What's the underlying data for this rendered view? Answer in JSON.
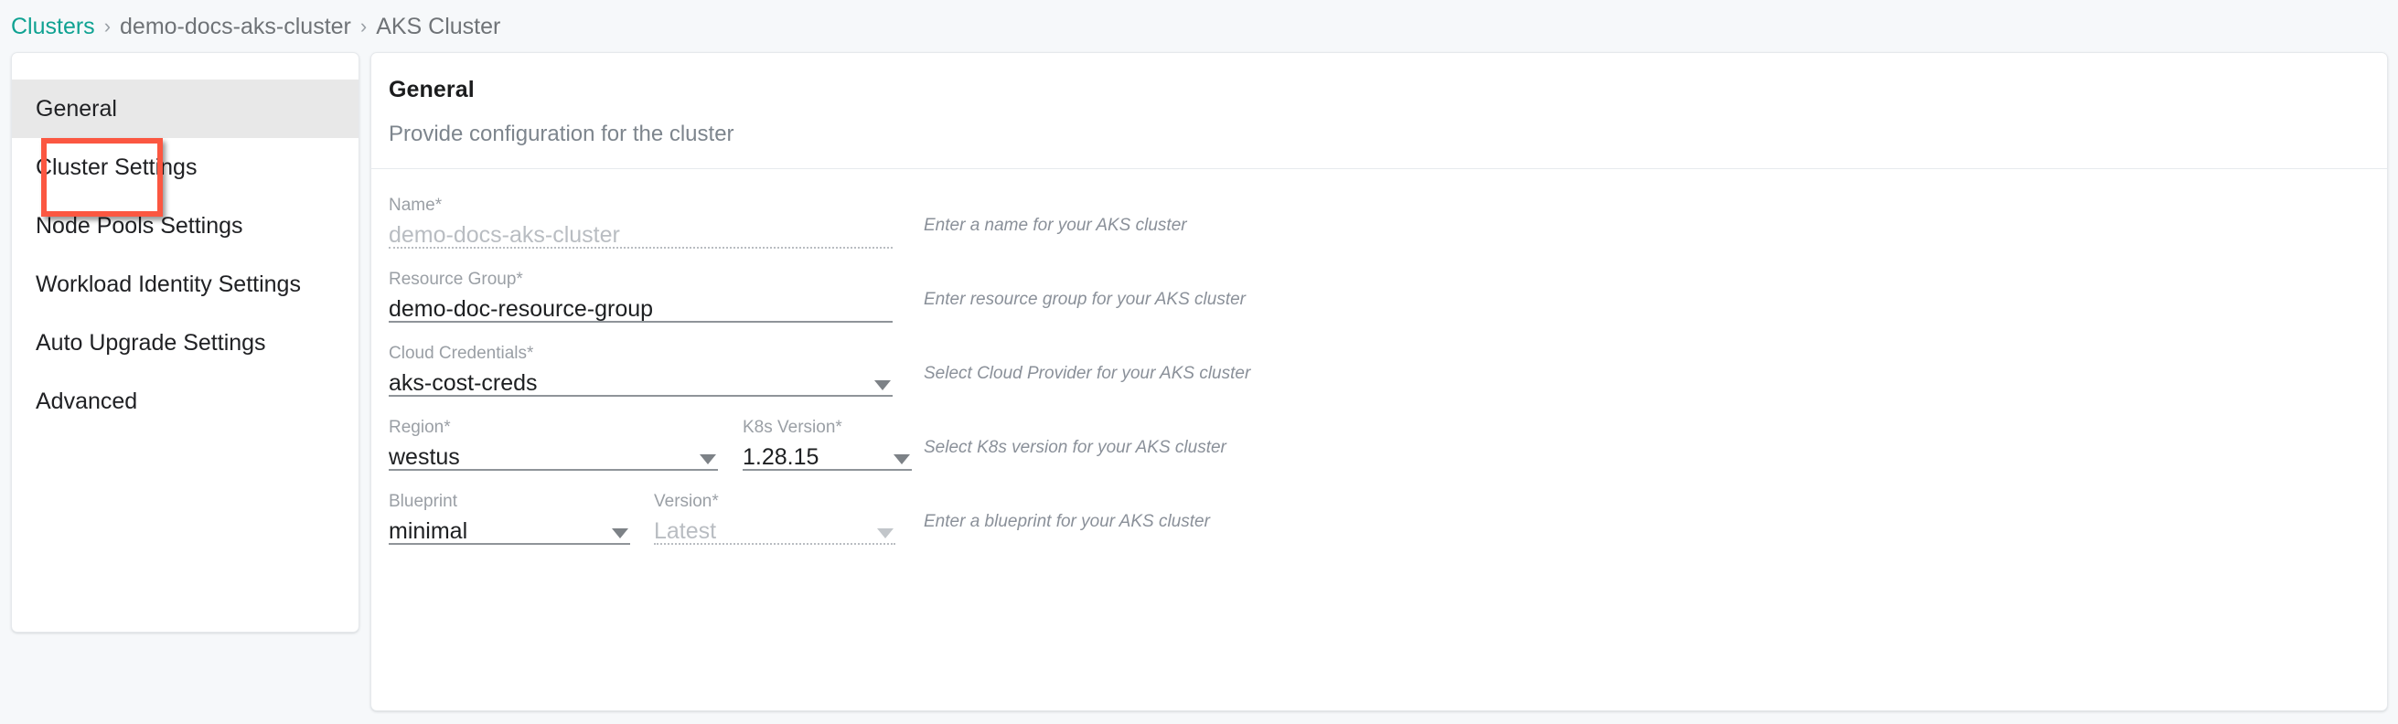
{
  "breadcrumb": {
    "root": "Clusters",
    "separator": "›",
    "cluster": "demo-docs-aks-cluster",
    "current": "AKS Cluster",
    "link_color": "#0fa292"
  },
  "sidebar": {
    "items": [
      {
        "label": "General",
        "selected": true
      },
      {
        "label": "Cluster Settings",
        "selected": false
      },
      {
        "label": "Node Pools Settings",
        "selected": false
      },
      {
        "label": "Workload Identity Settings",
        "selected": false
      },
      {
        "label": "Auto Upgrade Settings",
        "selected": false
      },
      {
        "label": "Advanced",
        "selected": false
      }
    ],
    "highlight_color": "#e8e8e8"
  },
  "annotation": {
    "color": "#fb5741"
  },
  "panel": {
    "title": "General",
    "subtitle": "Provide configuration for the cluster"
  },
  "form": {
    "name": {
      "label": "Name",
      "required_mark": "*",
      "value": "demo-docs-aks-cluster",
      "disabled": true,
      "helper": "Enter a name for your AKS cluster"
    },
    "resource_group": {
      "label": "Resource Group",
      "required_mark": "*",
      "value": "demo-doc-resource-group",
      "disabled": false,
      "helper": "Enter resource group for your AKS cluster"
    },
    "cloud_credentials": {
      "label": "Cloud Credentials",
      "required_mark": "*",
      "value": "aks-cost-creds",
      "disabled": false,
      "helper": "Select Cloud Provider for your AKS cluster"
    },
    "region": {
      "label": "Region",
      "required_mark": "*",
      "value": "westus",
      "disabled": false
    },
    "k8s_version": {
      "label": "K8s Version",
      "required_mark": "*",
      "value": "1.28.15",
      "disabled": false,
      "helper": "Select K8s version for your AKS cluster"
    },
    "blueprint": {
      "label": "Blueprint",
      "required_mark": "",
      "value": "minimal",
      "disabled": false,
      "helper": "Enter a blueprint for your AKS cluster"
    },
    "version": {
      "label": "Version",
      "required_mark": "*",
      "value": "Latest",
      "disabled": true
    }
  },
  "icons": {
    "dropdown": "chevron-down-icon"
  }
}
